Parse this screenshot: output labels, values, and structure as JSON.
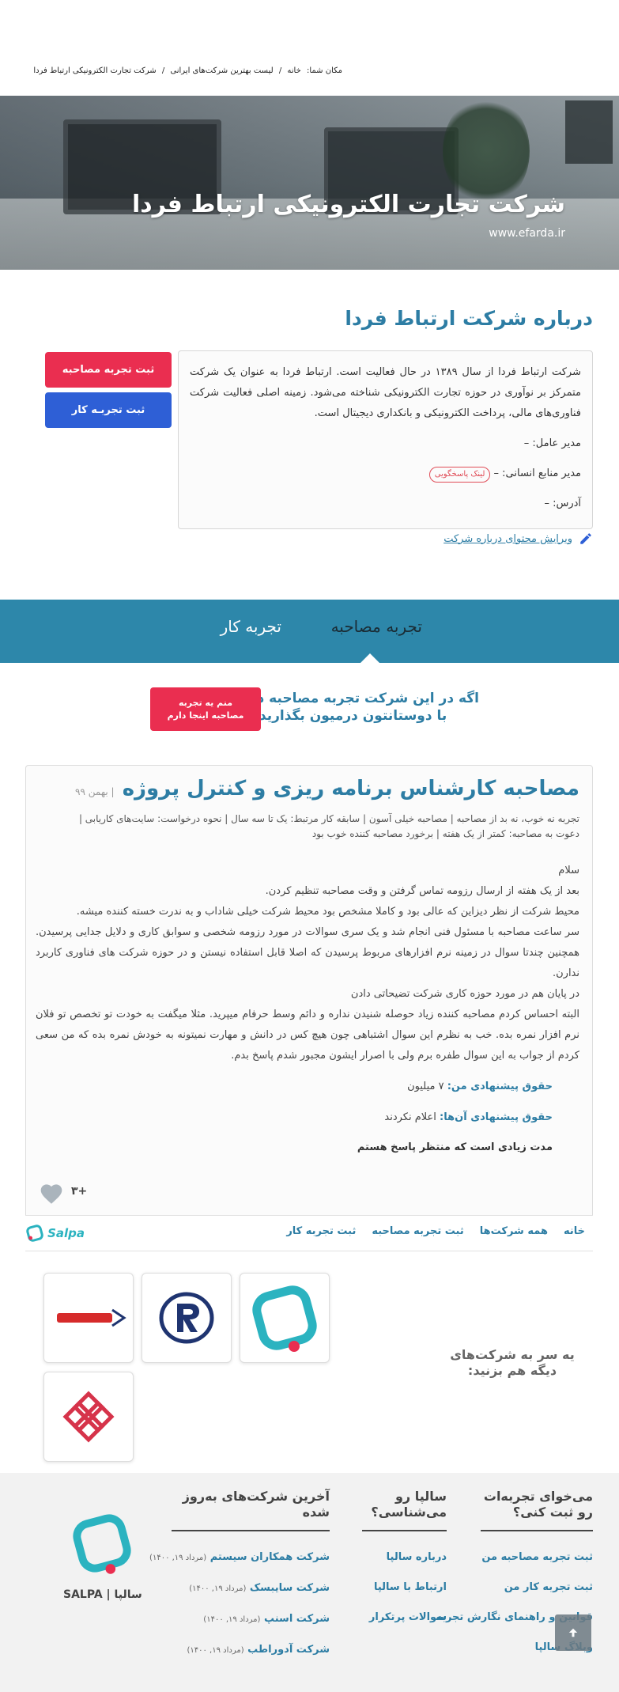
{
  "breadcrumb": {
    "prefix": "مکان شما:",
    "items": [
      "خانه",
      "لیست بهترین شرکت‌های ایرانی",
      "شرکت تجارت الکترونیکی ارتباط فردا"
    ],
    "separator": "/"
  },
  "hero": {
    "title": "شرکت تجارت الکترونیکی ارتباط فردا",
    "website": "www.efarda.ir"
  },
  "about": {
    "title": "درباره شرکت ارتباط فردا",
    "description": "شرکت ارتباط فردا از سال ۱۳۸۹ در حال فعالیت است. ارتباط فردا به عنوان یک شرکت متمرکز بر نوآوری در حوزه تجارت الکترونیکی شناخته می‌شود. زمینه اصلی فعالیت شرکت فناوری‌های مالی، پرداخت الکترونیکی و بانکداری دیجیتال است.",
    "ceo": "مدیر عامل: –",
    "hr": "مدیر منابع انسانی: –",
    "reply_link": "لینک پاسخگویی",
    "address": "آدرس: –",
    "edit_link": "ویرایش محتوای درباره شرکت"
  },
  "actions": {
    "interview_button": "ثبت تجربه مصاحبه",
    "work_button": "ثبت تجربـه کار"
  },
  "tabs": {
    "interview": "تجربه مصاحبه",
    "work": "تجربه کار"
  },
  "share": {
    "line1": "اگه در این شرکت تجربه مصاحبه دارید،",
    "line2": "با دوستانتون درمیون بگذارید",
    "button_line1": "منم یه تجربه",
    "button_line2": "مصاحبه اینجا دارم"
  },
  "review": {
    "title": "مصاحبه کارشناس برنامه ریزی و کنترل پروژه",
    "date": "| بهمن ۹۹",
    "meta": "تجربه نه خوب، نه بد از مصاحبه | مصاحبه خیلی آسون | سابقه کار مرتبط: یک تا سه سال | نحوه درخواست: سایت‌های کاریابی | دعوت به مصاحبه: کمتر از یک هفته | برخورد مصاحبه کننده خوب بود",
    "body": [
      "سلام",
      "بعد از یک هفته از ارسال رزومه تماس گرفتن و وقت مصاحبه تنظیم کردن.",
      "محیط شرکت از نظر دیزاین که عالی بود و کاملا مشخص بود محیط شرکت خیلی شاداب و به ندرت خسته کننده میشه.",
      "سر ساعت مصاحبه با مسئول فنی انجام شد و یک سری سوالات در مورد رزومه شخصی و سوابق کاری و دلایل جدایی پرسیدن. همچنین چندتا سوال در زمینه نرم افزارهای مربوط پرسیدن که اصلا قابل استفاده نیستن و در حوزه شرکت های فناوری کاربرد ندارن.",
      "در پایان هم در مورد حوزه کاری شرکت تضیحاتی دادن",
      "البته احساس کردم مصاحبه کننده زیاد حوصله شنیدن نداره و دائم وسط حرفام میپرید. مثلا میگفت به خودت تو تخصص تو فلان نرم افزار نمره بده. خب به نظرم این سوال اشتباهی چون هیچ کس در دانش و مهارت نمیتونه به خودش نمره بده که من سعی کردم از جواب به این سوال طفره برم ولی با اصرار ایشون مجبور شدم پاسخ بدم."
    ],
    "salary_offered_label": "حقوق پیشنهادی من:",
    "salary_offered_value": "۷ میلیون",
    "salary_their_label": "حقوق پیشنهادی آن‌ها:",
    "salary_their_value": "اعلام نکردند",
    "waiting": "مدت زیادی است که منتظر پاسخ هستم",
    "likes": "+۳"
  },
  "card_nav": [
    "خانه",
    "همه شرکت‌ها",
    "ثبت تجربه مصاحبه",
    "ثبت تجربه کار"
  ],
  "salpa_logo_text": "Salpa",
  "more_companies": {
    "title": "یه سر به شرکت‌های دیگه هم بزنید:"
  },
  "footer": {
    "col1_title": "می‌خوای تجربه‌ات رو ثبت کنی؟",
    "col1_links": [
      "ثبت تجربه مصاحبه من",
      "ثبت تجربه کار من",
      "قوانین و راهنمای نگارش تجربه",
      "وبلاگ سالپا"
    ],
    "col2_title": "سالپا رو می‌شناسی؟",
    "col2_links": [
      "درباره سالپا",
      "ارتباط با سالپا",
      "سوالات پرتکرار"
    ],
    "col3_title": "آخرین شرکت‌های به‌روز شده",
    "companies": [
      {
        "name": "شرکت همکاران سیستم",
        "date": "(مرداد ۱۹, ۱۴۰۰)"
      },
      {
        "name": "شرکت سایبسک",
        "date": "(مرداد ۱۹, ۱۴۰۰)"
      },
      {
        "name": "شرکت اسنپ",
        "date": "(مرداد ۱۹, ۱۴۰۰)"
      },
      {
        "name": "شرکت آدوراطب",
        "date": "(مرداد ۱۹, ۱۴۰۰)"
      }
    ],
    "brand": "SALPA | سالپا"
  },
  "colors": {
    "primary_blue": "#2d7da4",
    "tab_band": "#2d87aa",
    "accent_red": "#ea2e50",
    "accent_blue": "#2e5fd6",
    "logo_teal": "#2bb3c0"
  },
  "icons": [
    "pencil-icon",
    "heart-icon",
    "arrow-up-icon",
    "salpa-logo-icon"
  ]
}
